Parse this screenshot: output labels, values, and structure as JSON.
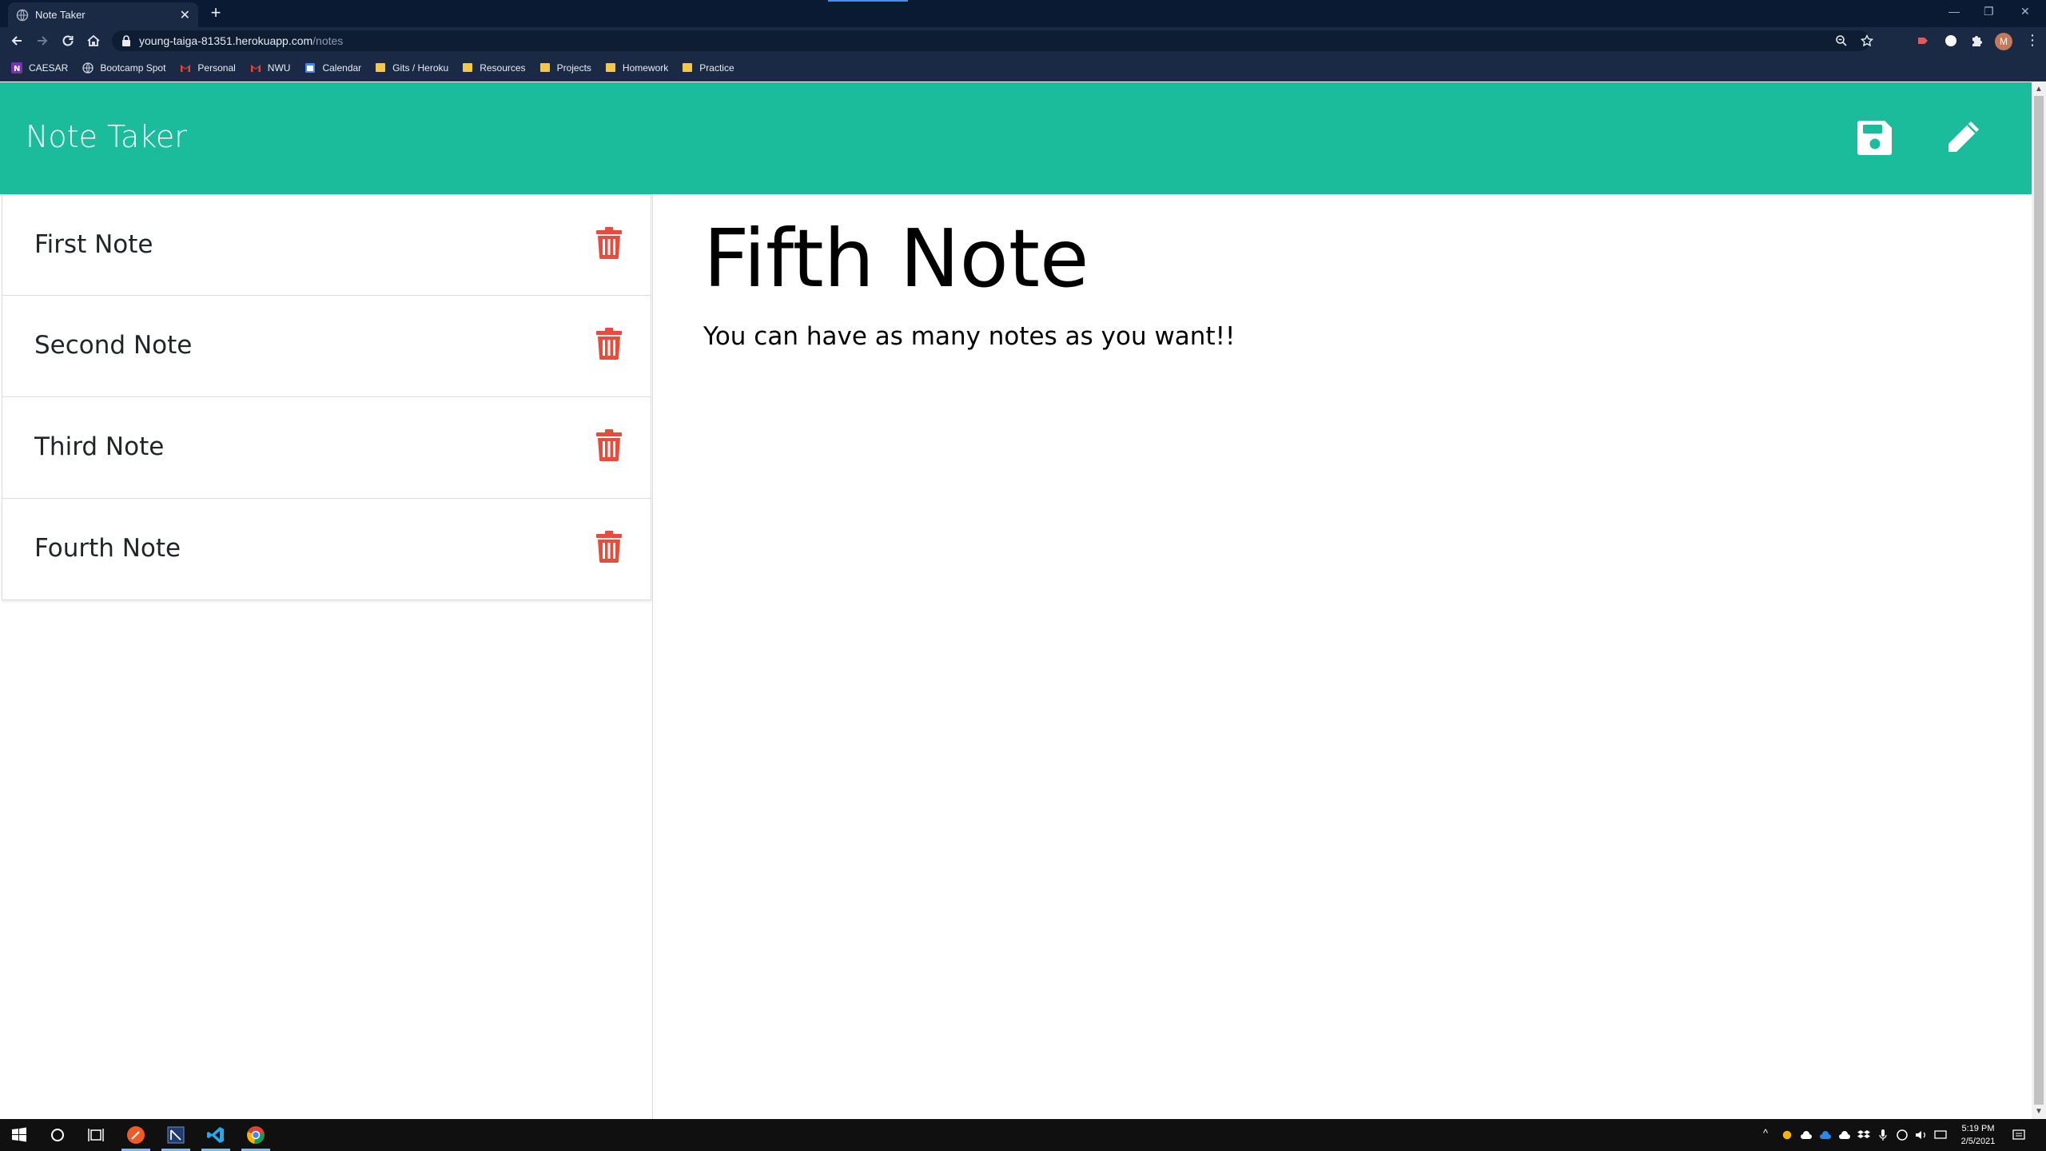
{
  "browser": {
    "tab_title": "Note Taker",
    "url_host": "young-taiga-81351.herokuapp.com",
    "url_path": "/notes",
    "profile_initial": "M",
    "bookmarks": [
      {
        "label": "CAESAR",
        "icon": "onenote-icon"
      },
      {
        "label": "Bootcamp Spot",
        "icon": "globe-icon"
      },
      {
        "label": "Personal",
        "icon": "gmail-icon"
      },
      {
        "label": "NWU",
        "icon": "gmail-icon"
      },
      {
        "label": "Calendar",
        "icon": "calendar-icon"
      },
      {
        "label": "Gits / Heroku",
        "icon": "folder-icon"
      },
      {
        "label": "Resources",
        "icon": "folder-icon"
      },
      {
        "label": "Projects",
        "icon": "folder-icon"
      },
      {
        "label": "Homework",
        "icon": "folder-icon"
      },
      {
        "label": "Practice",
        "icon": "folder-icon"
      }
    ]
  },
  "app": {
    "brand": "Note Taker",
    "accent_color": "#1abc9c",
    "delete_color": "#e74c3c",
    "save_icon": "save-icon",
    "new_icon": "pencil-icon"
  },
  "notes": [
    {
      "title": "First Note"
    },
    {
      "title": "Second Note"
    },
    {
      "title": "Third Note"
    },
    {
      "title": "Fourth Note"
    }
  ],
  "active_note": {
    "title": "Fifth Note",
    "text": "You can have as many notes as you want!!"
  },
  "taskbar": {
    "time": "5:19 PM",
    "date": "2/5/2021"
  }
}
